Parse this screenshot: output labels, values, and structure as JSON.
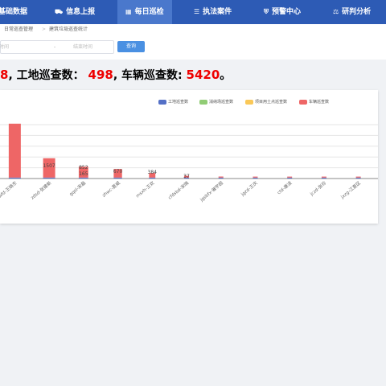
{
  "nav": {
    "items": [
      {
        "label": "基础数据",
        "icon": "database-icon",
        "active": false
      },
      {
        "label": "信息上报",
        "icon": "truck-icon",
        "active": false
      },
      {
        "label": "每日巡检",
        "icon": "calendar-icon",
        "active": true
      },
      {
        "label": "执法案件",
        "icon": "list-icon",
        "active": false
      },
      {
        "label": "预警中心",
        "icon": "shield-icon",
        "active": false
      },
      {
        "label": "研判分析",
        "icon": "balance-icon",
        "active": false
      }
    ]
  },
  "breadcrumb": {
    "item1": "日常巡查管理",
    "separator": ">",
    "item2": "建筑垃圾巡查统计"
  },
  "filter": {
    "start_placeholder": "时间",
    "range_separator": "-",
    "end_placeholder": "结束时间",
    "search_label": "查询"
  },
  "summary": {
    "first_value": "8",
    "site_label": "工地巡查数：",
    "site_value": "498",
    "vehicle_label": "车辆巡查数:",
    "vehicle_value": "5420",
    "end": "。"
  },
  "colors": {
    "nav_bg": "#2d5bb5",
    "accent": "#4a90e2",
    "highlight_number": "#e00000",
    "series_site": "#5470c6",
    "series_dump": "#91cc75",
    "series_project": "#fac858",
    "series_vehicle": "#ee6666"
  },
  "chart_data": {
    "type": "bar",
    "legend": [
      "工地巡查数",
      "消纳场巡查数",
      "项目用土点巡查数",
      "车辆巡查数"
    ],
    "legend_position": "top-right",
    "grid": true,
    "categories": [
      "gqwfd-王晓东",
      "zdsd-张建新",
      "gqsl-宋磊",
      "zhwc-夏威",
      "msxh-王欢",
      "cfdsbd-宋晓",
      "jgsbfx-催宇超",
      "jgzd-王庆",
      "ctd-康凌",
      "jczd-张珍",
      "jxzg-江夏区"
    ],
    "ylim": [
      0,
      4200
    ],
    "series": [
      {
        "name": "工地巡查数",
        "values": [
          60,
          50,
          30,
          40,
          30,
          20,
          10,
          10,
          10,
          10,
          5
        ]
      },
      {
        "name": "消纳场巡查数",
        "values": [
          0,
          0,
          0,
          0,
          0,
          0,
          0,
          0,
          0,
          0,
          0
        ]
      },
      {
        "name": "项目用土点巡查数",
        "values": [
          0,
          0,
          0,
          0,
          0,
          0,
          0,
          0,
          0,
          0,
          0
        ]
      },
      {
        "name": "车辆巡查数",
        "values": [
          4200,
          1507,
          852,
          670,
          360,
          140,
          80,
          70,
          60,
          30,
          20
        ]
      }
    ],
    "data_labels": [
      {
        "text": "1507"
      },
      {
        "text": "852"
      },
      {
        "text": "165"
      },
      {
        "text": "670"
      },
      {
        "text": "384"
      },
      {
        "text": "37"
      }
    ]
  }
}
